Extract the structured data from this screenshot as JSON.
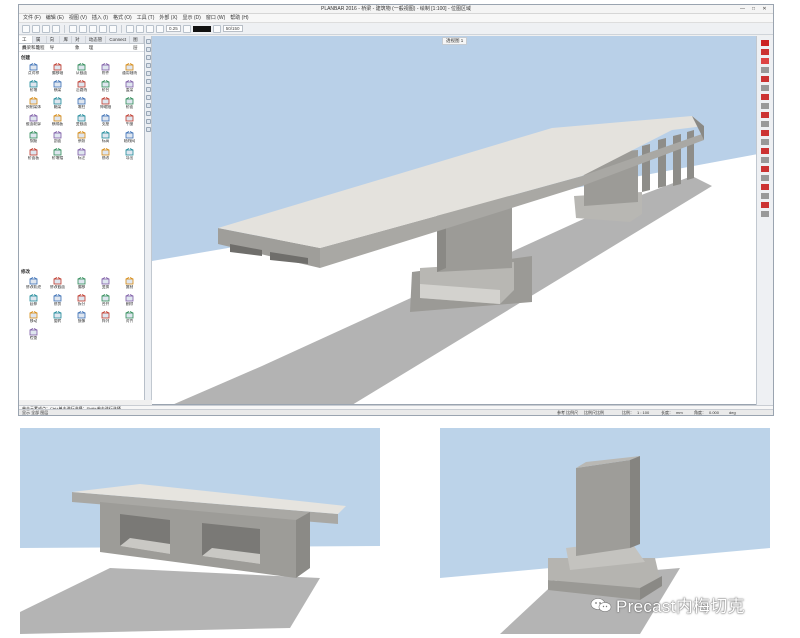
{
  "app": {
    "title": "PLANBAR 2016 - 桥梁 - 建筑物 (一般视图) - 绘制 [1:100] - 位图区域"
  },
  "menu": [
    "文件 (F)",
    "编辑 (E)",
    "视图 (V)",
    "插入 (I)",
    "格式 (O)",
    "工具 (T)",
    "外部 (X)",
    "显示 (D)",
    "窗口 (W)",
    "帮助 (H)"
  ],
  "toolbar": {
    "pen_value": "0.25",
    "scale_value": "50/150"
  },
  "left_panel": {
    "tabs": [
      "工具",
      "属性",
      "向导",
      "库",
      "对象",
      "动态管理",
      "Connect",
      "图层"
    ],
    "subtitle": "桥梁和工程",
    "section1_title": "创建",
    "section1_tools": [
      "点对称",
      "偏移轴",
      "从截面",
      "附件",
      "通用轴线",
      "桥墩",
      "横梁",
      "沿路线",
      "桥台",
      "盖梁",
      "预制梁体",
      "箱梁",
      "墩柱",
      "伸缩缝",
      "桥面",
      "截面轮廓",
      "横隔板",
      "变截面",
      "支座",
      "牛腿",
      "钢筋",
      "剖面",
      "参照",
      "标高",
      "轴线网",
      "桥面板",
      "桥墩帽",
      "标注",
      "修改",
      "导出"
    ],
    "section2_title": "修改",
    "section2_tools": [
      "修改轨迹",
      "修改截面",
      "偏移",
      "变换",
      "复制",
      "延伸",
      "修剪",
      "拆分",
      "合并",
      "删除",
      "移动",
      "旋转",
      "镜像",
      "阵列",
      "对齐",
      "检查"
    ]
  },
  "viewport": {
    "view_tab": "透视图 1"
  },
  "commandline": {
    "text": "单击元素或点；Ctrl+单击进行选择；Shift+单击进行选择"
  },
  "status": {
    "left": "显示 全部 图层",
    "middle_label": "参考 比例尺",
    "middle_value": "比例尺比例",
    "scale_label": "比例：",
    "scale_value": "1 : 100",
    "length_label": "长度：",
    "length_unit": "mm",
    "angle_label": "角度：",
    "angle_value": "0.000",
    "angle_unit": "deg"
  },
  "watermark": {
    "text": "Precast内梅切克"
  },
  "colors": {
    "sky": "#b9d0e8",
    "ground": "#ffffff",
    "shadow": "#b5b5b5",
    "deck": "#e3e1dc",
    "concrete": "#a9a8a5",
    "concrete_dark": "#8e8d8a"
  }
}
